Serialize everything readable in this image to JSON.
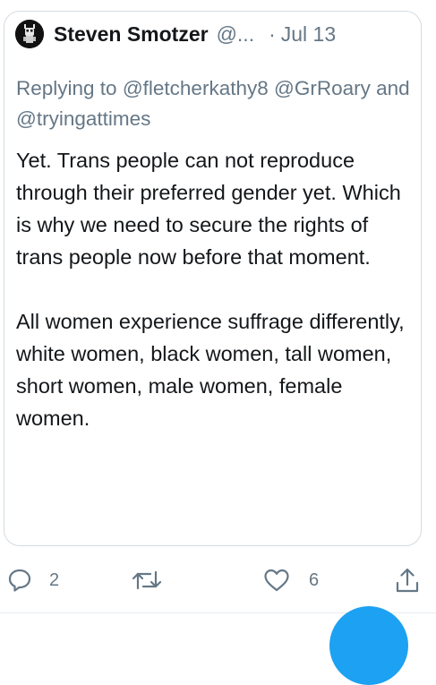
{
  "tweet": {
    "author": "Steven Smotzer",
    "handle": "@...",
    "separator": "·",
    "date": "Jul 13",
    "replying": "Replying to @fletcherkathy8 @GrRoary and @tryingattimes",
    "body_paragraphs": [
      "Yet. Trans people can not reproduce through their preferred gender yet. Which is why we need to secure the rights of trans people now before that moment.",
      "All women experience suffrage differently, white women, black women, tall women, short women, male women, female women."
    ]
  },
  "actions": {
    "reply_count": "2",
    "retweet_count": "",
    "like_count": "6"
  },
  "icons": [
    "avatar",
    "reply-icon",
    "retweet-icon",
    "like-icon",
    "share-icon",
    "compose-fab"
  ],
  "colors": {
    "muted": "#657786",
    "text": "#14171a",
    "border": "#d3dbe2",
    "accent": "#1da1f2"
  }
}
